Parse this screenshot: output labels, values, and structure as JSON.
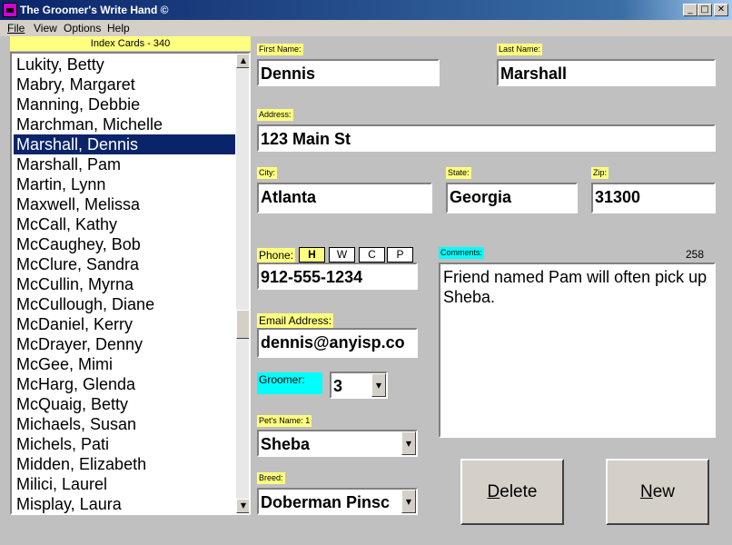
{
  "window": {
    "title": "The Groomer's Write Hand ©",
    "min_btn": "_",
    "max_btn": "□",
    "close_btn": "✕"
  },
  "menu": {
    "file": "File",
    "view": "View",
    "options": "Options",
    "help": "Help"
  },
  "list": {
    "header": "Index Cards  -  340",
    "selected_index": 4,
    "items": [
      "Lukity, Betty",
      "Mabry, Margaret",
      "Manning, Debbie",
      "Marchman, Michelle",
      "Marshall, Dennis",
      "Marshall, Pam",
      "Martin, Lynn",
      "Maxwell, Melissa",
      "McCall, Kathy",
      "McCaughey, Bob",
      "McClure, Sandra",
      "McCullin, Myrna",
      "McCullough, Diane",
      "McDaniel, Kerry",
      "McDrayer, Denny",
      "McGee, Mimi",
      "McHarg, Glenda",
      "McQuaig, Betty",
      "Michaels, Susan",
      "Michels, Pati",
      "Midden, Elizabeth",
      "Milici, Laurel",
      "Misplay, Laura"
    ]
  },
  "form": {
    "first_name_label": "First Name:",
    "first_name": "Dennis",
    "last_name_label": "Last Name:",
    "last_name": "Marshall",
    "address_label": "Address:",
    "address": "123 Main St",
    "city_label": "City:",
    "city": "Atlanta",
    "state_label": "State:",
    "state": "Georgia",
    "zip_label": "Zip:",
    "zip": "31300",
    "phone_label": "Phone:",
    "phone_tabs": [
      "H",
      "W",
      "C",
      "P"
    ],
    "phone": "912-555-1234",
    "email_label": "Email Address:",
    "email": "dennis@anyisp.co",
    "groomer_label": "Groomer:",
    "groomer": "3",
    "pets_name_label": "Pet's Name:  1",
    "pets_name": "Sheba",
    "breed_label": "Breed:",
    "breed": "Doberman Pinsc",
    "comments_label": "Comments:",
    "comments_count": "258",
    "comments": "Friend named Pam will often pick up Sheba."
  },
  "buttons": {
    "delete_hotkey": "D",
    "delete_rest": "elete",
    "new_hotkey": "N",
    "new_rest": "ew"
  },
  "colors": {
    "label_bg": "#ffff80",
    "cyan_label": "#00ffff",
    "selection": "#0a246a"
  }
}
